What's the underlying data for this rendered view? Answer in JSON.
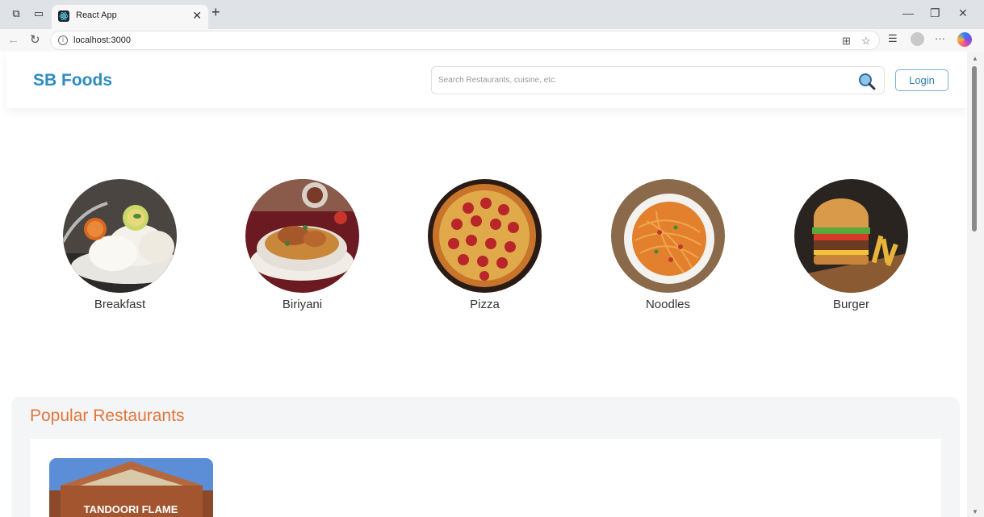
{
  "browser": {
    "tab_title": "React App",
    "url": "localhost:3000"
  },
  "header": {
    "logo": "SB Foods",
    "search_placeholder": "Search Restaurants, cuisine, etc.",
    "login_label": "Login"
  },
  "categories": [
    {
      "label": "Breakfast"
    },
    {
      "label": "Biriyani"
    },
    {
      "label": "Pizza"
    },
    {
      "label": "Noodles"
    },
    {
      "label": "Burger"
    }
  ],
  "popular": {
    "title": "Popular Restaurants",
    "restaurants": [
      {
        "sign": "TANDOORI FLAME"
      }
    ]
  },
  "colors": {
    "brand_blue": "#2e8bc0",
    "accent_orange": "#e1763c"
  }
}
